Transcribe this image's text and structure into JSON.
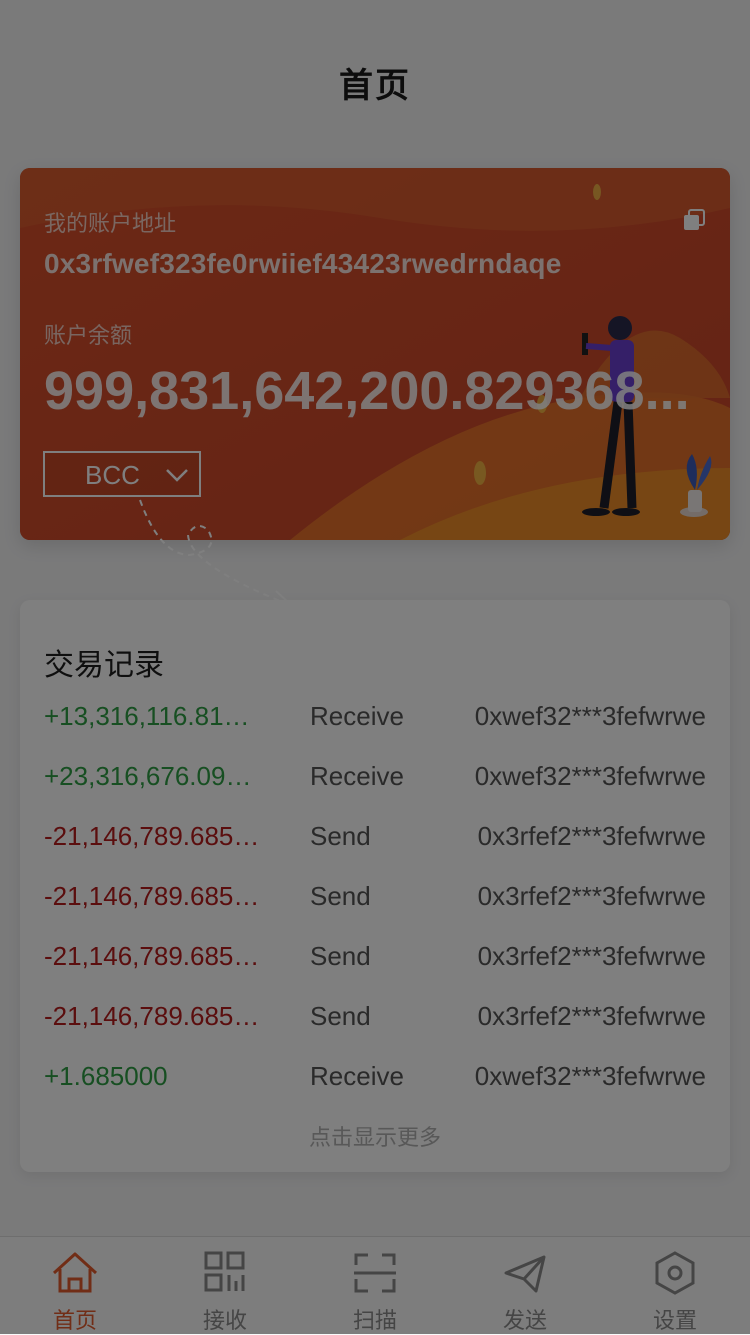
{
  "header": {
    "title": "首页"
  },
  "account": {
    "address_label": "我的账户地址",
    "address": "0x3rfwef323fe0rwiief43423rwedrndaqe",
    "balance_label": "账户余额",
    "balance": "999,831,642,200.829368...",
    "coin": "BCC",
    "colors": {
      "card": "#d4542d",
      "accent": "#f08a2c"
    }
  },
  "transactions": {
    "title": "交易记录",
    "rows": [
      {
        "amount": "+13,316,116.81…",
        "type": "Receive",
        "address": "0xwef32***3fefwrwe",
        "direction": "in"
      },
      {
        "amount": "+23,316,676.09…",
        "type": "Receive",
        "address": "0xwef32***3fefwrwe",
        "direction": "in"
      },
      {
        "amount": "-21,146,789.685…",
        "type": "Send",
        "address": "0x3rfef2***3fefwrwe",
        "direction": "out"
      },
      {
        "amount": "-21,146,789.685…",
        "type": "Send",
        "address": "0x3rfef2***3fefwrwe",
        "direction": "out"
      },
      {
        "amount": "-21,146,789.685…",
        "type": "Send",
        "address": "0x3rfef2***3fefwrwe",
        "direction": "out"
      },
      {
        "amount": "-21,146,789.685…",
        "type": "Send",
        "address": "0x3rfef2***3fefwrwe",
        "direction": "out"
      },
      {
        "amount": "+1.685000",
        "type": "Receive",
        "address": "0xwef32***3fefwrwe",
        "direction": "in"
      }
    ],
    "more_label": "点击显示更多"
  },
  "tabbar": {
    "items": [
      {
        "label": "首页",
        "icon": "home-icon",
        "active": true
      },
      {
        "label": "接收",
        "icon": "qr-code-icon",
        "active": false
      },
      {
        "label": "扫描",
        "icon": "scan-icon",
        "active": false
      },
      {
        "label": "发送",
        "icon": "send-icon",
        "active": false
      },
      {
        "label": "设置",
        "icon": "settings-icon",
        "active": false
      }
    ],
    "colors": {
      "active": "#e35b2d",
      "inactive": "#8a8a8a"
    }
  }
}
